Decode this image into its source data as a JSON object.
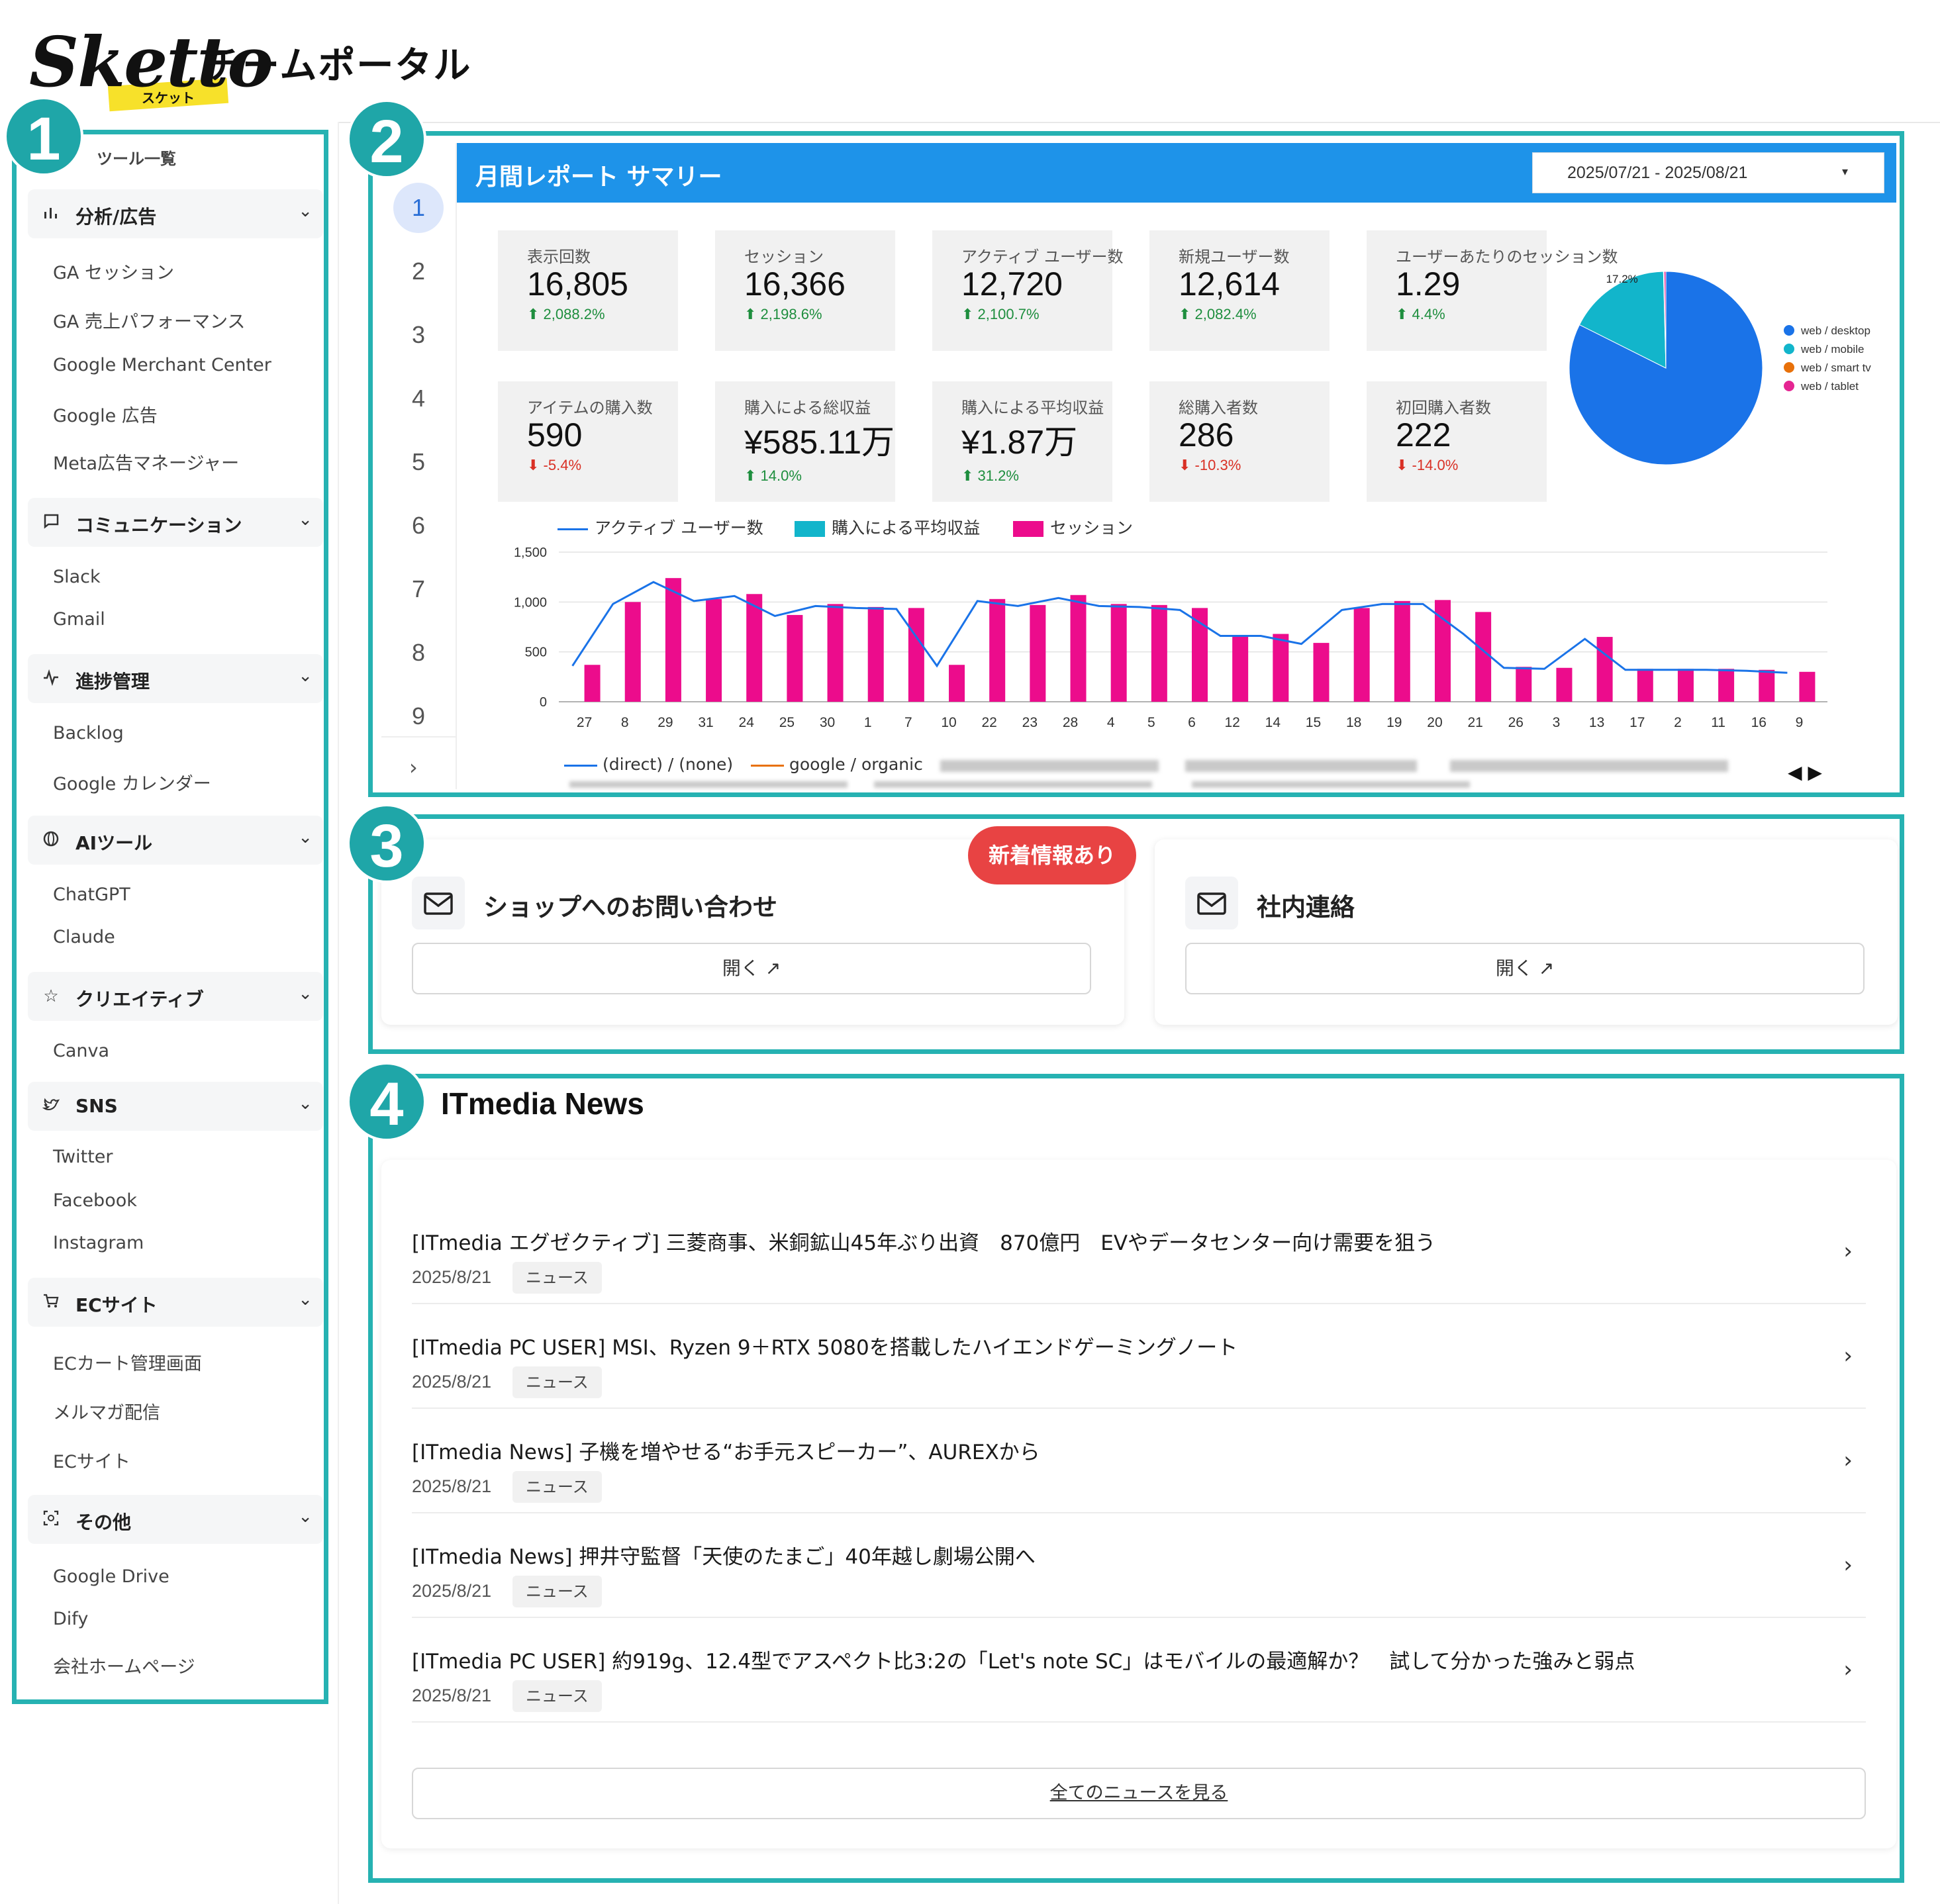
{
  "header": {
    "logo_text": "Sketto",
    "logo_ruby": "スケット",
    "portal_title": "チームポータル"
  },
  "badges": [
    "1",
    "2",
    "3",
    "4"
  ],
  "sidebar": {
    "title": "ツール一覧",
    "categories": [
      {
        "label": "分析/広告",
        "icon": "bar-chart-icon",
        "items": [
          "GA セッション",
          "GA 売上パフォーマンス",
          "Google Merchant Center",
          "Google 広告",
          "Meta広告マネージャー"
        ]
      },
      {
        "label": "コミュニケーション",
        "icon": "chat-bubble-icon",
        "items": [
          "Slack",
          "Gmail"
        ]
      },
      {
        "label": "進捗管理",
        "icon": "activity-icon",
        "items": [
          "Backlog",
          "Google カレンダー"
        ]
      },
      {
        "label": "AIツール",
        "icon": "ai-icon",
        "items": [
          "ChatGPT",
          "Claude"
        ]
      },
      {
        "label": "クリエイティブ",
        "icon": "star-icon",
        "items": [
          "Canva"
        ]
      },
      {
        "label": "SNS",
        "icon": "bird-icon",
        "items": [
          "Twitter",
          "Facebook",
          "Instagram"
        ]
      },
      {
        "label": "ECサイト",
        "icon": "cart-icon",
        "items": [
          "ECカート管理画面",
          "メルマガ配信",
          "ECサイト"
        ]
      },
      {
        "label": "その他",
        "icon": "scan-icon",
        "items": [
          "Google Drive",
          "Dify",
          "会社ホームページ"
        ]
      }
    ]
  },
  "report": {
    "title": "月間レポート サマリー",
    "date_range": "2025/07/21 - 2025/08/21",
    "pages": [
      "1",
      "2",
      "3",
      "4",
      "5",
      "6",
      "7",
      "8",
      "9"
    ],
    "active_page": "1",
    "kpis_row1": [
      {
        "label": "表示回数",
        "value": "16,805",
        "delta": "2,088.2%",
        "dir": "up"
      },
      {
        "label": "セッション",
        "value": "16,366",
        "delta": "2,198.6%",
        "dir": "up"
      },
      {
        "label": "アクティブ ユーザー数",
        "value": "12,720",
        "delta": "2,100.7%",
        "dir": "up"
      },
      {
        "label": "新規ユーザー数",
        "value": "12,614",
        "delta": "2,082.4%",
        "dir": "up"
      },
      {
        "label": "ユーザーあたりのセッション数",
        "value": "1.29",
        "delta": "4.4%",
        "dir": "up"
      }
    ],
    "kpis_row2": [
      {
        "label": "アイテムの購入数",
        "value": "590",
        "delta": "-5.4%",
        "dir": "down"
      },
      {
        "label": "購入による総収益",
        "value": "¥585.11万",
        "delta": "14.0%",
        "dir": "up"
      },
      {
        "label": "購入による平均収益",
        "value": "¥1.87万",
        "delta": "31.2%",
        "dir": "up"
      },
      {
        "label": "総購入者数",
        "value": "286",
        "delta": "-10.3%",
        "dir": "down"
      },
      {
        "label": "初回購入者数",
        "value": "222",
        "delta": "-14.0%",
        "dir": "down"
      }
    ],
    "bottom_legend": [
      "(direct) / (none)",
      "google / organic"
    ],
    "colors": {
      "header": "#1e93e9",
      "line": "#1a73e8",
      "bar": "#ec0c8c",
      "avg_revenue": "#12b5cb"
    }
  },
  "chart_data": [
    {
      "type": "pie",
      "labels": [
        "web / desktop",
        "web / mobile",
        "web / smart tv",
        "web / tablet"
      ],
      "values": [
        82.4,
        17.2,
        0.1,
        0.3
      ],
      "slice_labels": [
        "82.4%",
        "17.2%"
      ],
      "colors": [
        "#1a73e8",
        "#12b5cb",
        "#e8710a",
        "#e52592"
      ],
      "legend": "right"
    },
    {
      "type": "bar",
      "categories": [
        "27",
        "8",
        "29",
        "31",
        "24",
        "25",
        "30",
        "1",
        "7",
        "10",
        "22",
        "23",
        "28",
        "4",
        "5",
        "6",
        "12",
        "14",
        "15",
        "18",
        "19",
        "20",
        "21",
        "26",
        "3",
        "13",
        "17",
        "2",
        "11",
        "16",
        "9"
      ],
      "series": [
        {
          "name": "アクティブ ユーザー数",
          "kind": "line",
          "color": "#1a73e8",
          "values": [
            360,
            980,
            1200,
            1010,
            1060,
            860,
            960,
            940,
            930,
            360,
            1010,
            960,
            1040,
            960,
            950,
            920,
            660,
            660,
            580,
            920,
            980,
            980,
            680,
            340,
            330,
            630,
            320,
            320,
            320,
            310,
            290
          ]
        },
        {
          "name": "購入による平均収益",
          "kind": "bar",
          "color": "#12b5cb",
          "values": []
        },
        {
          "name": "セッション",
          "kind": "bar",
          "color": "#ec0c8c",
          "values": [
            370,
            1000,
            1240,
            1030,
            1080,
            870,
            980,
            950,
            940,
            370,
            1030,
            970,
            1070,
            980,
            970,
            940,
            670,
            680,
            590,
            940,
            1010,
            1020,
            900,
            350,
            340,
            650,
            330,
            330,
            330,
            320,
            300
          ]
        }
      ],
      "yticks": [
        "0",
        "500",
        "1,000",
        "1,500"
      ],
      "ylim": [
        0,
        1500
      ],
      "grid": true,
      "legend": "top-left"
    }
  ],
  "contacts": {
    "new_badge": "新着情報あり",
    "cards": [
      {
        "title": "ショップへのお問い合わせ",
        "button": "開く ↗"
      },
      {
        "title": "社内連絡",
        "button": "開く ↗"
      }
    ]
  },
  "news": {
    "title": "ITmedia News",
    "items": [
      {
        "headline": "[ITmedia エグゼクティブ] 三菱商事、米銅鉱山45年ぶり出資　870億円　EVやデータセンター向け需要を狙う",
        "date": "2025/8/21",
        "tag": "ニュース"
      },
      {
        "headline": "[ITmedia PC USER] MSI、Ryzen 9＋RTX 5080を搭載したハイエンドゲーミングノート",
        "date": "2025/8/21",
        "tag": "ニュース"
      },
      {
        "headline": "[ITmedia News] 子機を増やせる“お手元スピーカー”、AUREXから",
        "date": "2025/8/21",
        "tag": "ニュース"
      },
      {
        "headline": "[ITmedia News] 押井守監督「天使のたまご」40年越し劇場公開へ",
        "date": "2025/8/21",
        "tag": "ニュース"
      },
      {
        "headline": "[ITmedia PC USER] 約919g、12.4型でアスペクト比3:2の「Let's note SC」はモバイルの最適解か？　試して分かった強みと弱点",
        "date": "2025/8/21",
        "tag": "ニュース"
      }
    ],
    "all_button": "全てのニュースを見る"
  }
}
